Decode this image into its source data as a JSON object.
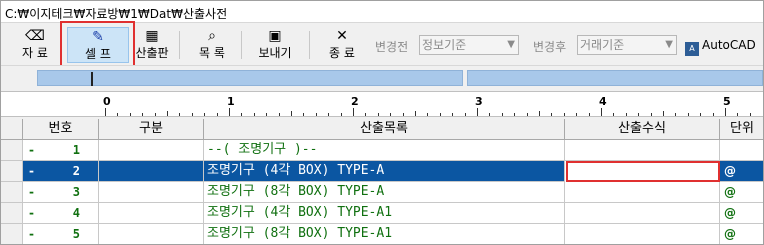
{
  "window": {
    "title": "C:₩이지테크₩자료방₩1₩Dat₩산출사전"
  },
  "toolbar": {
    "buttons": [
      {
        "name": "data-button",
        "label": "자 료"
      },
      {
        "name": "cell-button",
        "label": "셀 프"
      },
      {
        "name": "calc-panel-button",
        "label": "산출판"
      },
      {
        "name": "list-button",
        "label": "목 록"
      },
      {
        "name": "export-button",
        "label": "보내기"
      },
      {
        "name": "exit-button",
        "label": "종 료"
      }
    ],
    "before_change_label": "변경전",
    "before_change_value": "정보기준",
    "after_change_label": "변경후",
    "after_change_value": "거래기준",
    "autocad_label": "AutoCAD"
  },
  "ruler": {
    "marks": [
      "0",
      "1",
      "2",
      "3",
      "4",
      "5"
    ]
  },
  "grid": {
    "headers": [
      "번호",
      "구분",
      "산출목록",
      "산출수식",
      "단위"
    ],
    "rows": [
      {
        "marker": "-",
        "no": "1",
        "category": "",
        "name": "--( 조명기구 )--",
        "formula": "",
        "unit": ""
      },
      {
        "marker": "-",
        "no": "2",
        "category": "",
        "name": "조명기구 (4각 BOX) TYPE-A",
        "formula": "",
        "unit": "@"
      },
      {
        "marker": "-",
        "no": "3",
        "category": "",
        "name": "조명기구 (8각 BOX) TYPE-A",
        "formula": "",
        "unit": "@"
      },
      {
        "marker": "-",
        "no": "4",
        "category": "",
        "name": "조명기구 (4각 BOX) TYPE-A1",
        "formula": "",
        "unit": "@"
      },
      {
        "marker": "-",
        "no": "5",
        "category": "",
        "name": "조명기구 (8각 BOX) TYPE-A1",
        "formula": "",
        "unit": "@"
      }
    ],
    "selected_row": 2
  },
  "colors": {
    "selection": "#0b56a2",
    "highlight_box": "#e03030",
    "row_text": "#107010"
  }
}
